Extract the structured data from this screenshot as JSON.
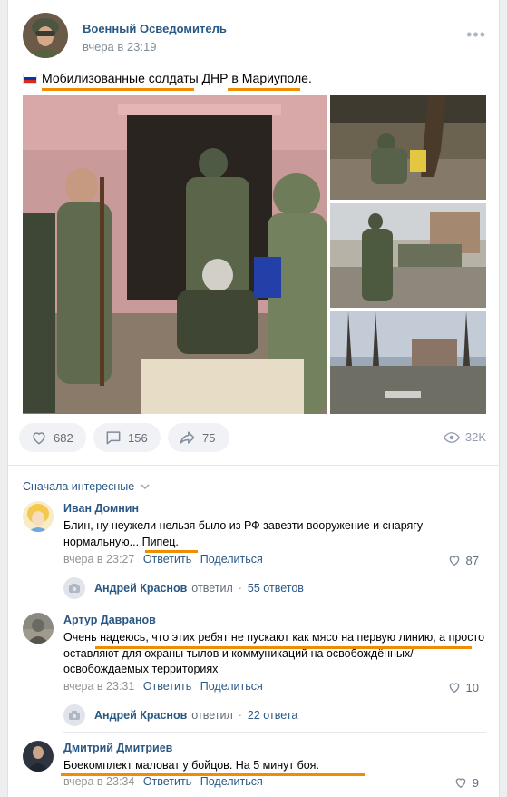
{
  "post": {
    "author": "Военный Осведомитель",
    "time": "вчера в 23:19",
    "more": "•••",
    "text_main": "Мобилизованные солдаты ДНР в Мариуполе.",
    "likes": "682",
    "comments": "156",
    "shares": "75",
    "views": "32K"
  },
  "comments_section": {
    "sort_label": "Сначала интересные",
    "items": [
      {
        "name": "Иван Домнин",
        "text": "Блин, ну неужели нельзя было из РФ завезти вооружение и снарягу нормальную... Пипец.",
        "time": "вчера в 23:27",
        "reply": "Ответить",
        "share": "Поделиться",
        "likes": "87",
        "replier": "Андрей Краснов",
        "replied_word": "ответил",
        "reply_count": "55 ответов"
      },
      {
        "name": "Артур Давранов",
        "text": "Очень надеюсь, что этих ребят не пускают как мясо на первую линию, а просто оставляют для охраны тылов и коммуникаций на освобождённых/освобождаемых территориях",
        "time": "вчера в 23:31",
        "reply": "Ответить",
        "share": "Поделиться",
        "likes": "10",
        "replier": "Андрей Краснов",
        "replied_word": "ответил",
        "reply_count": "22 ответа"
      },
      {
        "name": "Дмитрий Дмитриев",
        "text": "Боекомплект маловат у бойцов. На 5 минут боя.",
        "time": "вчера в 23:34",
        "reply": "Ответить",
        "share": "Поделиться",
        "likes": "9"
      }
    ]
  },
  "colors": {
    "link": "#2a5885",
    "accent_underline": "#f08c00",
    "button_bg": "#f0f2f5",
    "muted": "#939393"
  },
  "icons": [
    "heart-icon",
    "comment-icon",
    "share-icon",
    "eye-icon",
    "camera-icon",
    "chevron-down-icon",
    "more-icon"
  ]
}
